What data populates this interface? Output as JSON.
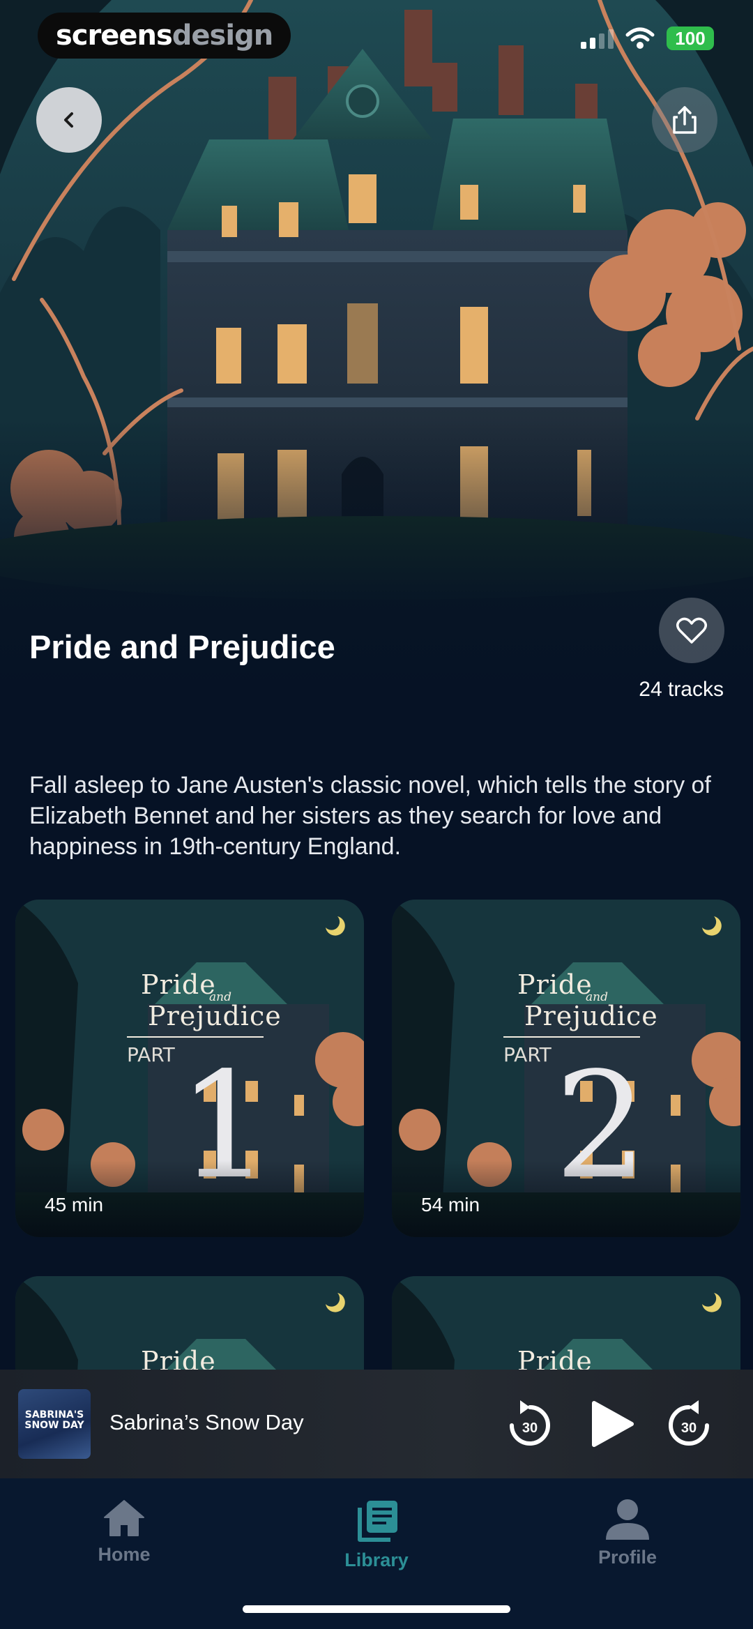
{
  "status_bar": {
    "watermark_a": "screens",
    "watermark_b": "design",
    "battery": "100"
  },
  "book": {
    "title": "Pride and Prejudice",
    "tracks": "24 tracks",
    "description": "Fall asleep to Jane Austen's classic novel, which tells the story of Elizabeth Bennet and her sisters as they search for love and happiness in 19th-century England."
  },
  "cover_art": {
    "title_top": "Pride",
    "title_and": "and",
    "title_bottom": "Prejudice",
    "part_label": "PART"
  },
  "tracks": [
    {
      "part": "1",
      "duration": "45 min"
    },
    {
      "part": "2",
      "duration": "54 min"
    },
    {
      "part": "",
      "duration": ""
    },
    {
      "part": "",
      "duration": ""
    }
  ],
  "mini_player": {
    "title": "Sabrina’s Snow Day",
    "art_text_1": "SABRINA'S",
    "art_text_2": "SNOW DAY",
    "skip_back_seconds": "30",
    "skip_forward_seconds": "30"
  },
  "tab_bar": {
    "items": [
      {
        "label": "Home",
        "icon": "home-icon",
        "active": false
      },
      {
        "label": "Library",
        "icon": "library-icon",
        "active": true
      },
      {
        "label": "Profile",
        "icon": "profile-icon",
        "active": false
      }
    ]
  },
  "colors": {
    "background": "#061225",
    "accent": "#2c8f96",
    "tab_inactive": "#6b7789",
    "battery": "#2fbd4c"
  }
}
